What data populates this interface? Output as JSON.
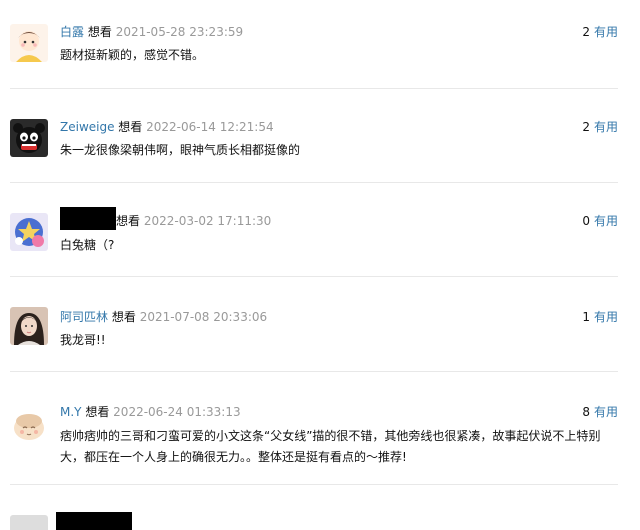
{
  "comments": [
    {
      "user": "白露",
      "action": "想看",
      "time": "2021-05-28 23:23:59",
      "count": "2",
      "useful_label": "有用",
      "text": "题材挺新颖的，感觉不错。"
    },
    {
      "user": "Zeiweige",
      "action": "想看",
      "time": "2022-06-14 12:21:54",
      "count": "2",
      "useful_label": "有用",
      "text": "朱一龙很像梁朝伟啊，眼神气质长相都挺像的"
    },
    {
      "user": "",
      "action": "想看",
      "time": "2022-03-02 17:11:30",
      "count": "0",
      "useful_label": "有用",
      "text": "白兔糖（?"
    },
    {
      "user": "阿司匹林",
      "action": "想看",
      "time": "2021-07-08 20:33:06",
      "count": "1",
      "useful_label": "有用",
      "text": "我龙哥!!"
    },
    {
      "user": "M.Y",
      "action": "想看",
      "time": "2022-06-24 01:33:13",
      "count": "8",
      "useful_label": "有用",
      "text": "痞帅痞帅的三哥和刁蛮可爱的小文这条“父女线”描的很不错，其他旁线也很紧凑，故事起伏说不上特别大，都压在一个人身上的确很无力。。整体还是挺有看点的～推荐!"
    }
  ],
  "colors": {
    "link": "#3377aa",
    "time": "#999999",
    "divider": "#e8e8e8"
  }
}
